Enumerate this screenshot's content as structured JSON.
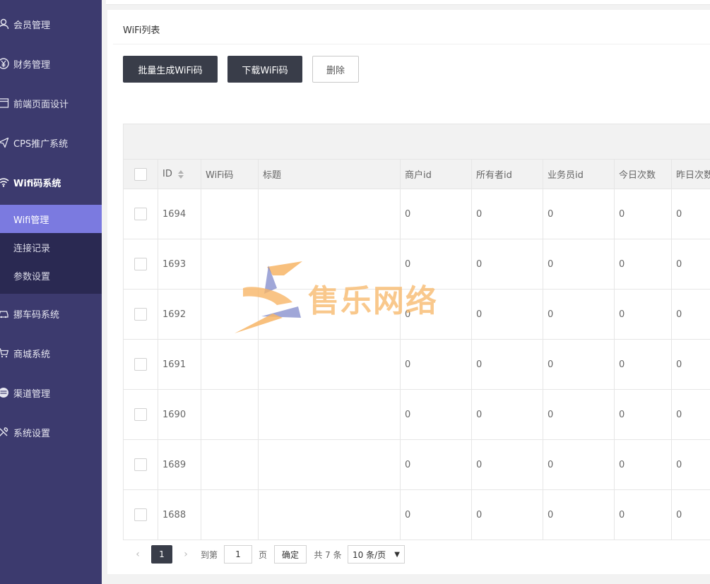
{
  "sidebar": {
    "items": [
      {
        "label": "会员管理",
        "icon": "user-icon"
      },
      {
        "label": "财务管理",
        "icon": "yen-icon"
      },
      {
        "label": "前端页面设计",
        "icon": "layout-icon"
      },
      {
        "label": "CPS推广系统",
        "icon": "send-icon"
      },
      {
        "label": "Wifi码系统",
        "icon": "wifi-icon"
      },
      {
        "label": "挪车码系统",
        "icon": "car-icon"
      },
      {
        "label": "商城系统",
        "icon": "cart-icon"
      },
      {
        "label": "渠道管理",
        "icon": "list-icon"
      },
      {
        "label": "系统设置",
        "icon": "tools-icon"
      }
    ],
    "submenu": [
      {
        "label": "Wifi管理"
      },
      {
        "label": "连接记录"
      },
      {
        "label": "参数设置"
      }
    ]
  },
  "card": {
    "title": "WiFi列表"
  },
  "actions": {
    "batch_generate": "批量生成WiFi码",
    "download": "下载WiFi码",
    "delete": "删除"
  },
  "table": {
    "columns": [
      "ID",
      "WiFi码",
      "标题",
      "商户id",
      "所有者id",
      "业务员id",
      "今日次数",
      "昨日次数"
    ],
    "rows": [
      {
        "id": "1694",
        "wifi": "",
        "title": "",
        "merchant": "0",
        "owner": "0",
        "salesman": "0",
        "today": "0",
        "yesterday": "0"
      },
      {
        "id": "1693",
        "wifi": "",
        "title": "",
        "merchant": "0",
        "owner": "0",
        "salesman": "0",
        "today": "0",
        "yesterday": "0"
      },
      {
        "id": "1692",
        "wifi": "",
        "title": "",
        "merchant": "0",
        "owner": "0",
        "salesman": "0",
        "today": "0",
        "yesterday": "0"
      },
      {
        "id": "1691",
        "wifi": "",
        "title": "",
        "merchant": "0",
        "owner": "0",
        "salesman": "0",
        "today": "0",
        "yesterday": "0"
      },
      {
        "id": "1690",
        "wifi": "",
        "title": "",
        "merchant": "0",
        "owner": "0",
        "salesman": "0",
        "today": "0",
        "yesterday": "0"
      },
      {
        "id": "1689",
        "wifi": "",
        "title": "",
        "merchant": "0",
        "owner": "0",
        "salesman": "0",
        "today": "0",
        "yesterday": "0"
      },
      {
        "id": "1688",
        "wifi": "",
        "title": "",
        "merchant": "0",
        "owner": "0",
        "salesman": "0",
        "today": "0",
        "yesterday": "0"
      }
    ]
  },
  "pagination": {
    "current_page": "1",
    "goto_label": "到第",
    "goto_value": "1",
    "page_unit": "页",
    "confirm": "确定",
    "total": "共 7 条",
    "page_size": "10 条/页"
  },
  "watermark": {
    "text": "售乐网络"
  },
  "colors": {
    "sidebar_bg": "#3c3a6e",
    "submenu_bg": "#2a2952",
    "active_item": "#7b7ae0",
    "dark_button": "#393d49",
    "watermark": "#f7b566"
  }
}
